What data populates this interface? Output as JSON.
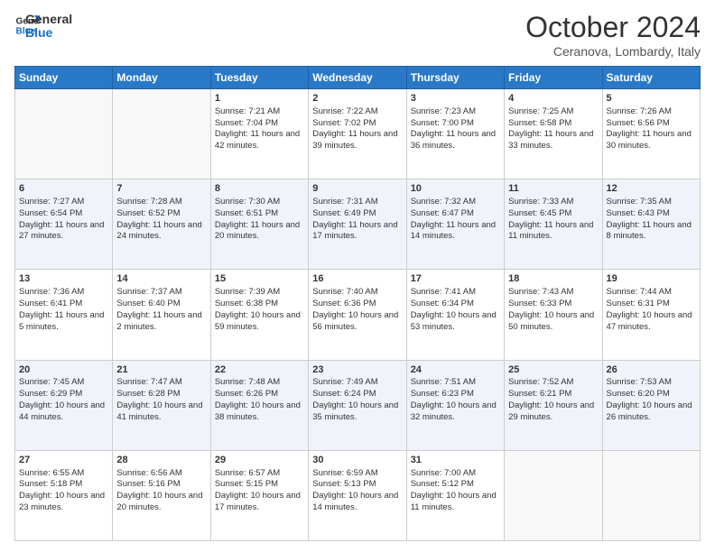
{
  "header": {
    "logo_general": "General",
    "logo_blue": "Blue",
    "month_title": "October 2024",
    "location": "Ceranova, Lombardy, Italy"
  },
  "days_of_week": [
    "Sunday",
    "Monday",
    "Tuesday",
    "Wednesday",
    "Thursday",
    "Friday",
    "Saturday"
  ],
  "weeks": [
    [
      {
        "day": "",
        "sunrise": "",
        "sunset": "",
        "daylight": ""
      },
      {
        "day": "",
        "sunrise": "",
        "sunset": "",
        "daylight": ""
      },
      {
        "day": "1",
        "sunrise": "Sunrise: 7:21 AM",
        "sunset": "Sunset: 7:04 PM",
        "daylight": "Daylight: 11 hours and 42 minutes."
      },
      {
        "day": "2",
        "sunrise": "Sunrise: 7:22 AM",
        "sunset": "Sunset: 7:02 PM",
        "daylight": "Daylight: 11 hours and 39 minutes."
      },
      {
        "day": "3",
        "sunrise": "Sunrise: 7:23 AM",
        "sunset": "Sunset: 7:00 PM",
        "daylight": "Daylight: 11 hours and 36 minutes."
      },
      {
        "day": "4",
        "sunrise": "Sunrise: 7:25 AM",
        "sunset": "Sunset: 6:58 PM",
        "daylight": "Daylight: 11 hours and 33 minutes."
      },
      {
        "day": "5",
        "sunrise": "Sunrise: 7:26 AM",
        "sunset": "Sunset: 6:56 PM",
        "daylight": "Daylight: 11 hours and 30 minutes."
      }
    ],
    [
      {
        "day": "6",
        "sunrise": "Sunrise: 7:27 AM",
        "sunset": "Sunset: 6:54 PM",
        "daylight": "Daylight: 11 hours and 27 minutes."
      },
      {
        "day": "7",
        "sunrise": "Sunrise: 7:28 AM",
        "sunset": "Sunset: 6:52 PM",
        "daylight": "Daylight: 11 hours and 24 minutes."
      },
      {
        "day": "8",
        "sunrise": "Sunrise: 7:30 AM",
        "sunset": "Sunset: 6:51 PM",
        "daylight": "Daylight: 11 hours and 20 minutes."
      },
      {
        "day": "9",
        "sunrise": "Sunrise: 7:31 AM",
        "sunset": "Sunset: 6:49 PM",
        "daylight": "Daylight: 11 hours and 17 minutes."
      },
      {
        "day": "10",
        "sunrise": "Sunrise: 7:32 AM",
        "sunset": "Sunset: 6:47 PM",
        "daylight": "Daylight: 11 hours and 14 minutes."
      },
      {
        "day": "11",
        "sunrise": "Sunrise: 7:33 AM",
        "sunset": "Sunset: 6:45 PM",
        "daylight": "Daylight: 11 hours and 11 minutes."
      },
      {
        "day": "12",
        "sunrise": "Sunrise: 7:35 AM",
        "sunset": "Sunset: 6:43 PM",
        "daylight": "Daylight: 11 hours and 8 minutes."
      }
    ],
    [
      {
        "day": "13",
        "sunrise": "Sunrise: 7:36 AM",
        "sunset": "Sunset: 6:41 PM",
        "daylight": "Daylight: 11 hours and 5 minutes."
      },
      {
        "day": "14",
        "sunrise": "Sunrise: 7:37 AM",
        "sunset": "Sunset: 6:40 PM",
        "daylight": "Daylight: 11 hours and 2 minutes."
      },
      {
        "day": "15",
        "sunrise": "Sunrise: 7:39 AM",
        "sunset": "Sunset: 6:38 PM",
        "daylight": "Daylight: 10 hours and 59 minutes."
      },
      {
        "day": "16",
        "sunrise": "Sunrise: 7:40 AM",
        "sunset": "Sunset: 6:36 PM",
        "daylight": "Daylight: 10 hours and 56 minutes."
      },
      {
        "day": "17",
        "sunrise": "Sunrise: 7:41 AM",
        "sunset": "Sunset: 6:34 PM",
        "daylight": "Daylight: 10 hours and 53 minutes."
      },
      {
        "day": "18",
        "sunrise": "Sunrise: 7:43 AM",
        "sunset": "Sunset: 6:33 PM",
        "daylight": "Daylight: 10 hours and 50 minutes."
      },
      {
        "day": "19",
        "sunrise": "Sunrise: 7:44 AM",
        "sunset": "Sunset: 6:31 PM",
        "daylight": "Daylight: 10 hours and 47 minutes."
      }
    ],
    [
      {
        "day": "20",
        "sunrise": "Sunrise: 7:45 AM",
        "sunset": "Sunset: 6:29 PM",
        "daylight": "Daylight: 10 hours and 44 minutes."
      },
      {
        "day": "21",
        "sunrise": "Sunrise: 7:47 AM",
        "sunset": "Sunset: 6:28 PM",
        "daylight": "Daylight: 10 hours and 41 minutes."
      },
      {
        "day": "22",
        "sunrise": "Sunrise: 7:48 AM",
        "sunset": "Sunset: 6:26 PM",
        "daylight": "Daylight: 10 hours and 38 minutes."
      },
      {
        "day": "23",
        "sunrise": "Sunrise: 7:49 AM",
        "sunset": "Sunset: 6:24 PM",
        "daylight": "Daylight: 10 hours and 35 minutes."
      },
      {
        "day": "24",
        "sunrise": "Sunrise: 7:51 AM",
        "sunset": "Sunset: 6:23 PM",
        "daylight": "Daylight: 10 hours and 32 minutes."
      },
      {
        "day": "25",
        "sunrise": "Sunrise: 7:52 AM",
        "sunset": "Sunset: 6:21 PM",
        "daylight": "Daylight: 10 hours and 29 minutes."
      },
      {
        "day": "26",
        "sunrise": "Sunrise: 7:53 AM",
        "sunset": "Sunset: 6:20 PM",
        "daylight": "Daylight: 10 hours and 26 minutes."
      }
    ],
    [
      {
        "day": "27",
        "sunrise": "Sunrise: 6:55 AM",
        "sunset": "Sunset: 5:18 PM",
        "daylight": "Daylight: 10 hours and 23 minutes."
      },
      {
        "day": "28",
        "sunrise": "Sunrise: 6:56 AM",
        "sunset": "Sunset: 5:16 PM",
        "daylight": "Daylight: 10 hours and 20 minutes."
      },
      {
        "day": "29",
        "sunrise": "Sunrise: 6:57 AM",
        "sunset": "Sunset: 5:15 PM",
        "daylight": "Daylight: 10 hours and 17 minutes."
      },
      {
        "day": "30",
        "sunrise": "Sunrise: 6:59 AM",
        "sunset": "Sunset: 5:13 PM",
        "daylight": "Daylight: 10 hours and 14 minutes."
      },
      {
        "day": "31",
        "sunrise": "Sunrise: 7:00 AM",
        "sunset": "Sunset: 5:12 PM",
        "daylight": "Daylight: 10 hours and 11 minutes."
      },
      {
        "day": "",
        "sunrise": "",
        "sunset": "",
        "daylight": ""
      },
      {
        "day": "",
        "sunrise": "",
        "sunset": "",
        "daylight": ""
      }
    ]
  ]
}
